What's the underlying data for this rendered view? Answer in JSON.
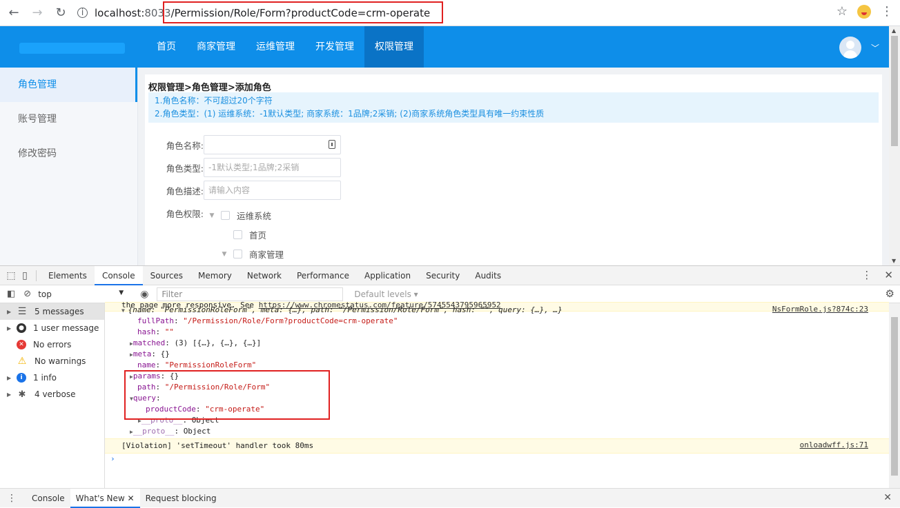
{
  "browser": {
    "url_host": "localhost:",
    "url_port": "8033",
    "url_path": "/Permission/Role/Form?productCode=crm-operate"
  },
  "header": {
    "nav": [
      "首页",
      "商家管理",
      "运维管理",
      "开发管理",
      "权限管理"
    ],
    "active_nav": "权限管理"
  },
  "sidebar": {
    "items": [
      {
        "label": "角色管理"
      },
      {
        "label": "账号管理"
      },
      {
        "label": "修改密码"
      }
    ]
  },
  "main": {
    "breadcrumb": "权限管理>角色管理>添加角色",
    "tip_line1": "1.角色名称：不可超过20个字符",
    "tip_line2": "2.角色类型：(1) 运维系统：-1默认类型; 商家系统：1品牌;2采销; (2)商家系统角色类型具有唯一约束性质",
    "form": {
      "name_label": "角色名称:",
      "type_label": "角色类型:",
      "type_placeholder": "-1默认类型;1品牌;2采销",
      "desc_label": "角色描述:",
      "desc_placeholder": "请输入内容",
      "perm_label": "角色权限:",
      "tree": [
        "运维系统",
        "首页",
        "商家管理"
      ]
    }
  },
  "devtools": {
    "tabs": [
      "Elements",
      "Console",
      "Sources",
      "Memory",
      "Network",
      "Performance",
      "Application",
      "Security",
      "Audits"
    ],
    "active_tab": "Console",
    "context": "top",
    "filter_placeholder": "Filter",
    "levels": "Default levels ▾",
    "sidebar": [
      {
        "label": "5 messages",
        "icon": "list-icon"
      },
      {
        "label": "1 user message",
        "icon": "user-icon"
      },
      {
        "label": "No errors",
        "icon": "error-icon"
      },
      {
        "label": "No warnings",
        "icon": "warning-icon"
      },
      {
        "label": "1 info",
        "icon": "info-icon"
      },
      {
        "label": "4 verbose",
        "icon": "bug-icon"
      }
    ],
    "console": {
      "line_top": "the page more responsive. See ",
      "line_top_link": "https://www.chromestatus.com/feature/5745543795965952",
      "obj_summary": "{name: \"PermissionRoleForm\", meta: {…}, path: \"/Permission/Role/Form\", hash: \"\", query: {…}, …}",
      "obj_source": "NsFormRole.js?874c:23",
      "fullPath": "\"/Permission/Role/Form?productCode=crm-operate\"",
      "hash": "\"\"",
      "matched": "(3) [{…}, {…}, {…}]",
      "meta": "{}",
      "name": "\"PermissionRoleForm\"",
      "params": "{}",
      "path": "\"/Permission/Role/Form\"",
      "productCode": "\"crm-operate\"",
      "proto_inner": "Object",
      "proto_outer": "Object",
      "violation": "[Violation] 'setTimeout' handler took 80ms",
      "violation_source": "onloadwff.js:71"
    },
    "drawer_tabs": [
      "Console",
      "What's New",
      "Request blocking"
    ],
    "active_drawer": "What's New"
  }
}
